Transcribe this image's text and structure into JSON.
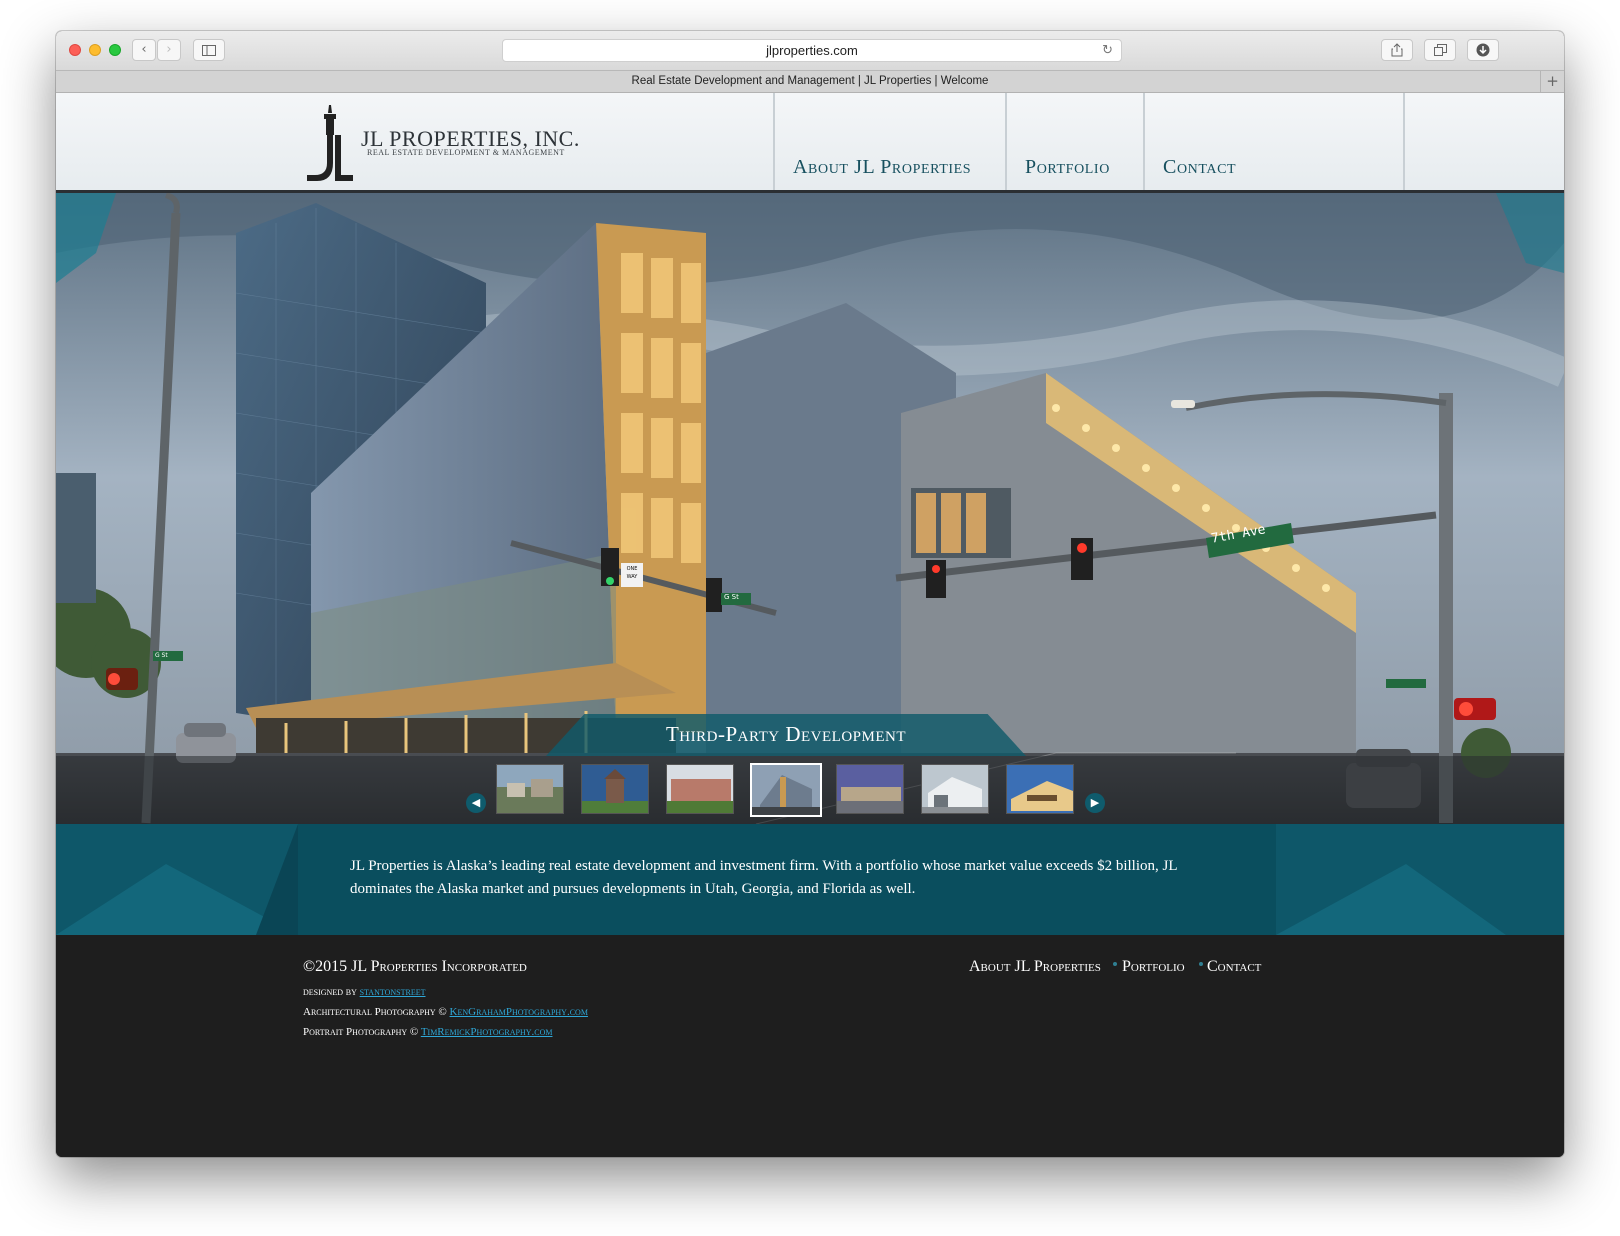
{
  "browser": {
    "url": "jlproperties.com",
    "tab_title": "Real Estate Development and Management | JL Properties | Welcome"
  },
  "site": {
    "logo_name": "JL PROPERTIES, INC.",
    "logo_tagline": "REAL ESTATE DEVELOPMENT & MANAGEMENT",
    "nav": [
      {
        "label": "About JL Properties"
      },
      {
        "label": "Portfolio"
      },
      {
        "label": "Contact"
      }
    ]
  },
  "hero": {
    "caption": "Third-Party Development",
    "street_signs": [
      "7th Ave",
      "G St",
      "G St",
      "ONE WAY"
    ],
    "active_thumbnail": 4,
    "thumbnail_count": 7
  },
  "intro": {
    "text": "JL Properties is Alaska’s leading real estate development and investment firm. With a portfolio whose market value exceeds $2 billion, JL dominates the Alaska market and pursues developments in Utah, Georgia, and Florida as well."
  },
  "footer": {
    "copyright": "©2015 JL Properties Incorporated",
    "designed_prefix": "designed by",
    "designed_link": "stantonstreet",
    "arch_prefix": "Architectural Photography ©",
    "arch_link": "KenGrahamPhotography.com",
    "portrait_prefix": "Portrait Photography ©",
    "portrait_link": "TimRemickPhotography.com",
    "nav": [
      "About JL Properties",
      "Portfolio",
      "Contact"
    ]
  },
  "colors": {
    "teal": "#0e5769",
    "nav_text": "#17505f",
    "footer_bg": "#1e1e1e",
    "link": "#2fa8d8"
  }
}
